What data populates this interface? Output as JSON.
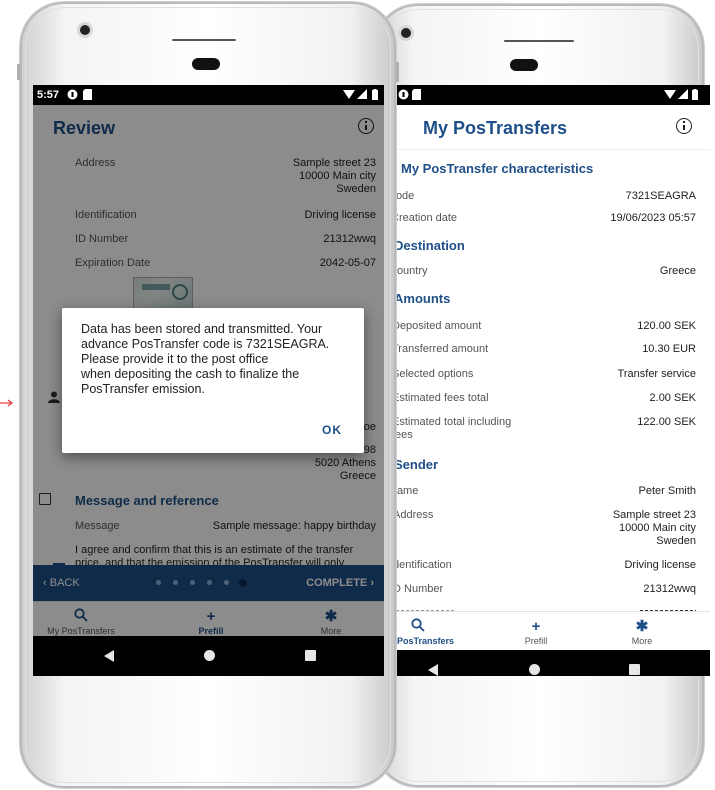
{
  "left": {
    "status_time": "5:57",
    "title": "Review",
    "rows": [
      {
        "label": "Address",
        "value_lines": [
          "Sample street 23",
          "10000 Main city",
          "Sweden"
        ]
      },
      {
        "label": "Identification",
        "value": "Driving license"
      },
      {
        "label": "ID Number",
        "value": "21312wwq"
      },
      {
        "label": "Expiration Date",
        "value": "2042-05-07"
      }
    ],
    "peek": {
      "oe": "oe",
      "code_partial": "98",
      "city": "5020 Athens",
      "country": "Greece"
    },
    "message_section": {
      "title": "Message and reference",
      "label": "Message",
      "value": "Sample message: happy birthday"
    },
    "agree_text": [
      "I agree and confirm that this is an estimate of the transfer",
      "price, and that the emission of the PosTransfer will only"
    ],
    "wizard": {
      "back": "BACK",
      "complete": "COMPLETE",
      "step_count": 6,
      "active_step": 6
    },
    "dialog": {
      "message_lines": [
        "Data has been stored and transmitted. Your",
        "advance PosTransfer code is 7321SEAGRA.",
        "Please provide it to the post office",
        "when depositing the cash to finalize the",
        "PosTransfer emission."
      ],
      "ok": "OK"
    },
    "nav": [
      {
        "label": "My PosTransfers",
        "icon": "search-icon"
      },
      {
        "label": "Prefill",
        "icon": "plus-icon"
      },
      {
        "label": "More",
        "icon": "gear-icon"
      }
    ]
  },
  "right": {
    "title": "My PosTransfers",
    "sections": {
      "characteristics": "My PosTransfer characteristics",
      "destination": "Destination",
      "amounts": "Amounts",
      "sender": "Sender"
    },
    "rows": {
      "code": {
        "label": "Code",
        "value": "7321SEAGRA"
      },
      "creation": {
        "label": "Creation date",
        "value": "19/06/2023 05:57"
      },
      "country": {
        "label": "Country",
        "value": "Greece"
      },
      "deposited": {
        "label": "Deposited amount",
        "value": "120.00 SEK"
      },
      "transferred": {
        "label": "Transferred amount",
        "value": "10.30 EUR"
      },
      "options": {
        "label": "Selected options",
        "value": "Transfer service"
      },
      "fees": {
        "label": "Estimated fees total",
        "value": "2.00 SEK"
      },
      "total": {
        "label_lines": [
          "Estimated total including",
          "fees"
        ],
        "value": "122.00 SEK"
      },
      "name": {
        "label": "Name",
        "value": "Peter Smith"
      },
      "address": {
        "label": "Address",
        "value_lines": [
          "Sample street 23",
          "10000 Main city",
          "Sweden"
        ]
      },
      "identification": {
        "label": "Identification",
        "value": "Driving license"
      },
      "id_number": {
        "label": "ID Number",
        "value": "21312wwq"
      }
    },
    "nav": [
      {
        "label": "My PosTransfers",
        "icon": "search-icon"
      },
      {
        "label": "Prefill",
        "icon": "plus-icon"
      },
      {
        "label": "More",
        "icon": "gear-icon"
      }
    ]
  },
  "colors": {
    "brand_blue": "#1e4f88",
    "system_bar": "#000000"
  }
}
